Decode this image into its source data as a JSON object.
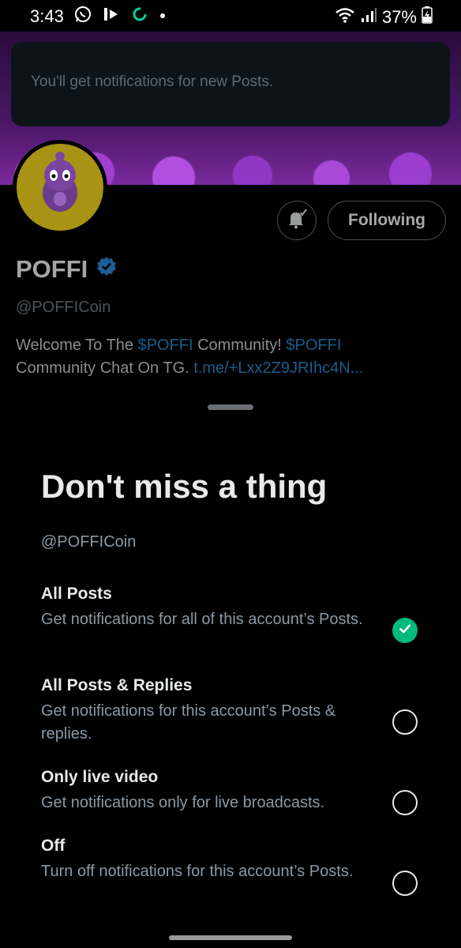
{
  "status_bar": {
    "time": "3:43",
    "battery": "37%"
  },
  "toast": {
    "message": "You'll get notifications for new Posts."
  },
  "profile": {
    "name": "POFFI",
    "handle": "@POFFICoin",
    "follow_label": "Following",
    "bio": {
      "part1": "Welcome To The ",
      "link1": "$POFFI",
      "part2": " Community!  ",
      "link2": "$POFFI",
      "part3": "Community Chat On TG.  ",
      "link3": "t.me/+Lxx2Z9JRIhc4N..."
    }
  },
  "sheet": {
    "title": "Don't miss a thing",
    "handle": "@POFFICoin",
    "options": [
      {
        "title": "All Posts",
        "desc": "Get notifications for all of this account’s Posts.",
        "selected": true
      },
      {
        "title": "All Posts & Replies",
        "desc": "Get notifications for this account’s Posts & replies.",
        "selected": false
      },
      {
        "title": "Only live video",
        "desc": "Get notifications only for live broadcasts.",
        "selected": false
      },
      {
        "title": "Off",
        "desc": "Turn off notifications for this account’s Posts.",
        "selected": false
      }
    ]
  },
  "colors": {
    "accent_green": "#00ba7c",
    "link_blue": "#1d9bf0",
    "verified_blue": "#1d9bf0"
  },
  "icons": [
    "whatsapp-icon",
    "play-icon",
    "sync-icon",
    "dot-icon",
    "wifi-icon",
    "signal-icon",
    "battery-icon",
    "bell-icon",
    "verified-badge-icon",
    "check-icon"
  ]
}
